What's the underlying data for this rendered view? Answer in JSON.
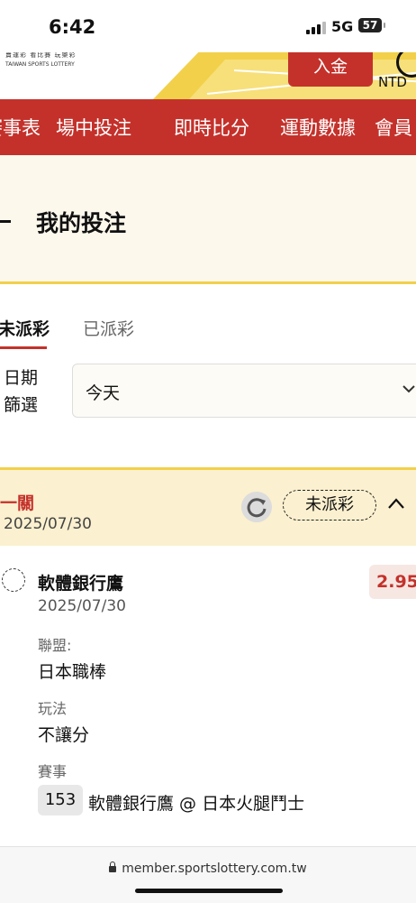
{
  "status_bar": {
    "time": "6:42",
    "network": "5G",
    "battery": "57"
  },
  "header": {
    "logo_top": "賣運彩 看比賽 玩樂彩",
    "logo_bottom": "TAIWAN SPORTS LOTTERY",
    "deposit_label": "入金",
    "currency": "NTD",
    "brand_color": "#c4312b",
    "accent_yellow": "#f2d04a"
  },
  "nav": {
    "items": [
      "賽事表",
      "場中投注",
      "即時比分",
      "運動數據",
      "會員"
    ]
  },
  "page": {
    "title": "我的投注"
  },
  "tabs": {
    "active": "未派彩",
    "inactive": "已派彩"
  },
  "filter": {
    "label_line1": "日期",
    "label_line2": "篩選",
    "value": "今天",
    "icon": "chevron-down-icon"
  },
  "bet": {
    "type": "一關",
    "date": "2025/07/30",
    "status": "未派彩",
    "refresh_icon": "refresh-icon",
    "collapse_icon": "chevron-up-icon",
    "selection": {
      "team": "軟體銀行鷹",
      "odds": "2.95",
      "date": "2025/07/30",
      "league_label": "聯盟:",
      "league": "日本職棒",
      "market_label": "玩法",
      "market": "不讓分",
      "event_label": "賽事",
      "event_number": "153",
      "event_name": "軟體銀行鷹 @ 日本火腿鬥士"
    }
  },
  "browser": {
    "url": "member.sportslottery.com.tw"
  }
}
